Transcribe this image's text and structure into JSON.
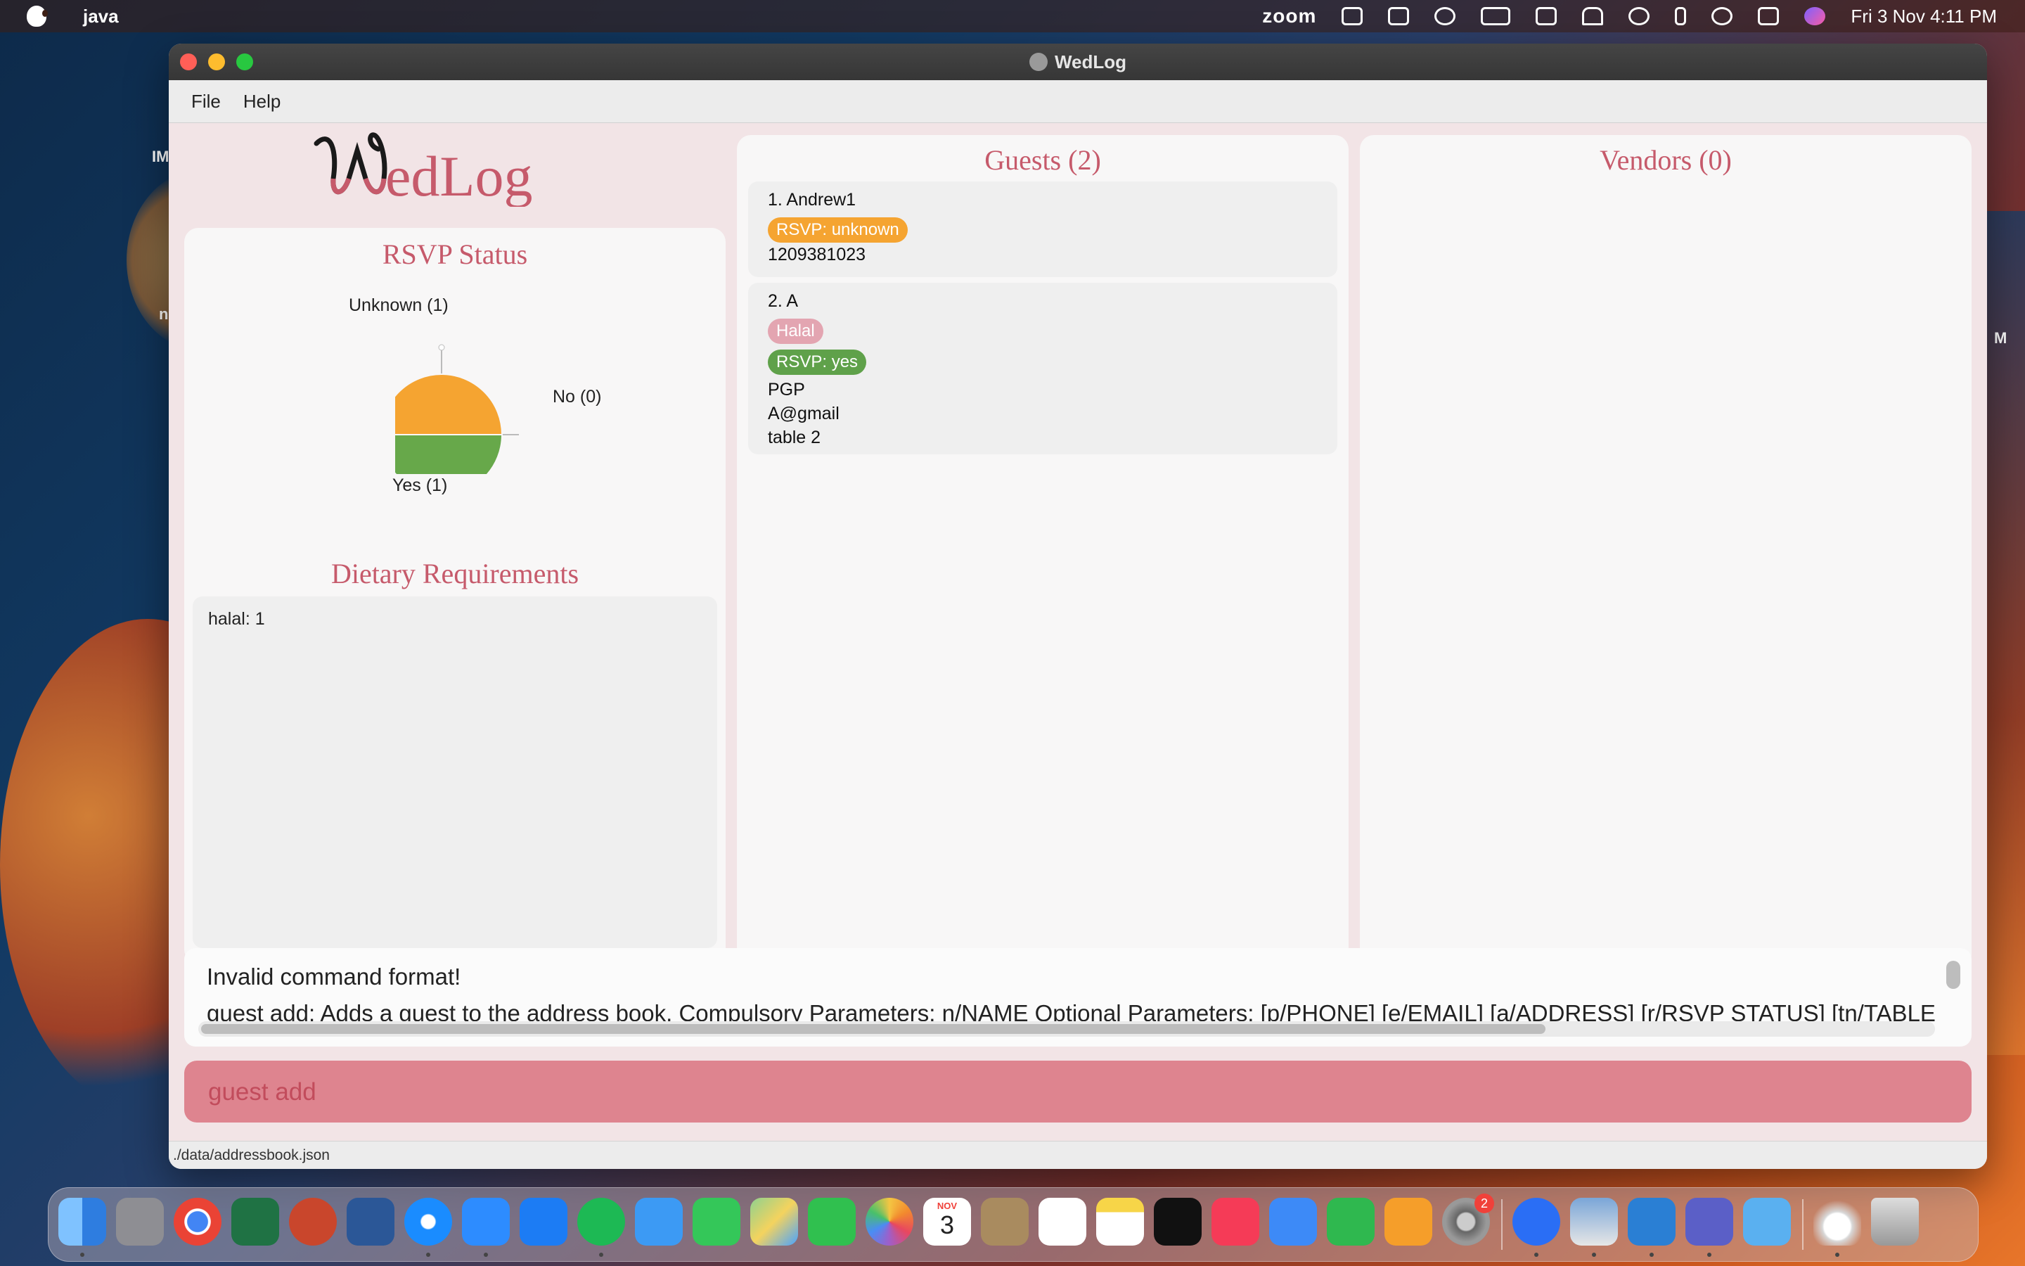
{
  "os_menubar": {
    "app_name": "java",
    "zoom_label": "zoom",
    "clock": "Fri 3 Nov  4:11 PM"
  },
  "desktop": {
    "left_label_1": "IM",
    "left_label_2": "n",
    "right_label": "M"
  },
  "window": {
    "title": "WedLog",
    "menu": [
      "File",
      "Help"
    ]
  },
  "rsvp": {
    "title": "RSVP Status",
    "slices": [
      {
        "label": "Unknown (1)",
        "value": 1,
        "color": "#f5a431"
      },
      {
        "label": "Yes (1)",
        "value": 1,
        "color": "#67a84a"
      },
      {
        "label": "No (0)",
        "value": 0,
        "color": "#c9c9c9"
      }
    ]
  },
  "dietary": {
    "title": "Dietary Requirements",
    "items": [
      "halal: 1"
    ]
  },
  "guests": {
    "title": "Guests (2)",
    "list": [
      {
        "name": "1.  Andrew1",
        "tags": [],
        "rsvp": "RSVP: unknown",
        "lines": [
          "1209381023"
        ]
      },
      {
        "name": "2.  A",
        "tags": [
          "Halal"
        ],
        "rsvp": "RSVP: yes",
        "lines": [
          "PGP",
          "A@gmail",
          "table 2"
        ]
      }
    ]
  },
  "vendors": {
    "title": "Vendors (0)"
  },
  "result": {
    "line1": "Invalid command format!",
    "line2": "guest add: Adds a guest to the address book. Compulsory Parameters: n/NAME Optional Parameters: [p/PHONE] [e/EMAIL] [a/ADDRESS] [r/RSVP STATUS] [tn/TABLE_NUMBER]"
  },
  "command": {
    "value": "guest add"
  },
  "status": {
    "path": "./data/addressbook.json"
  },
  "dock": {
    "calendar_month": "NOV",
    "calendar_day": "3",
    "settings_badge": "2"
  }
}
